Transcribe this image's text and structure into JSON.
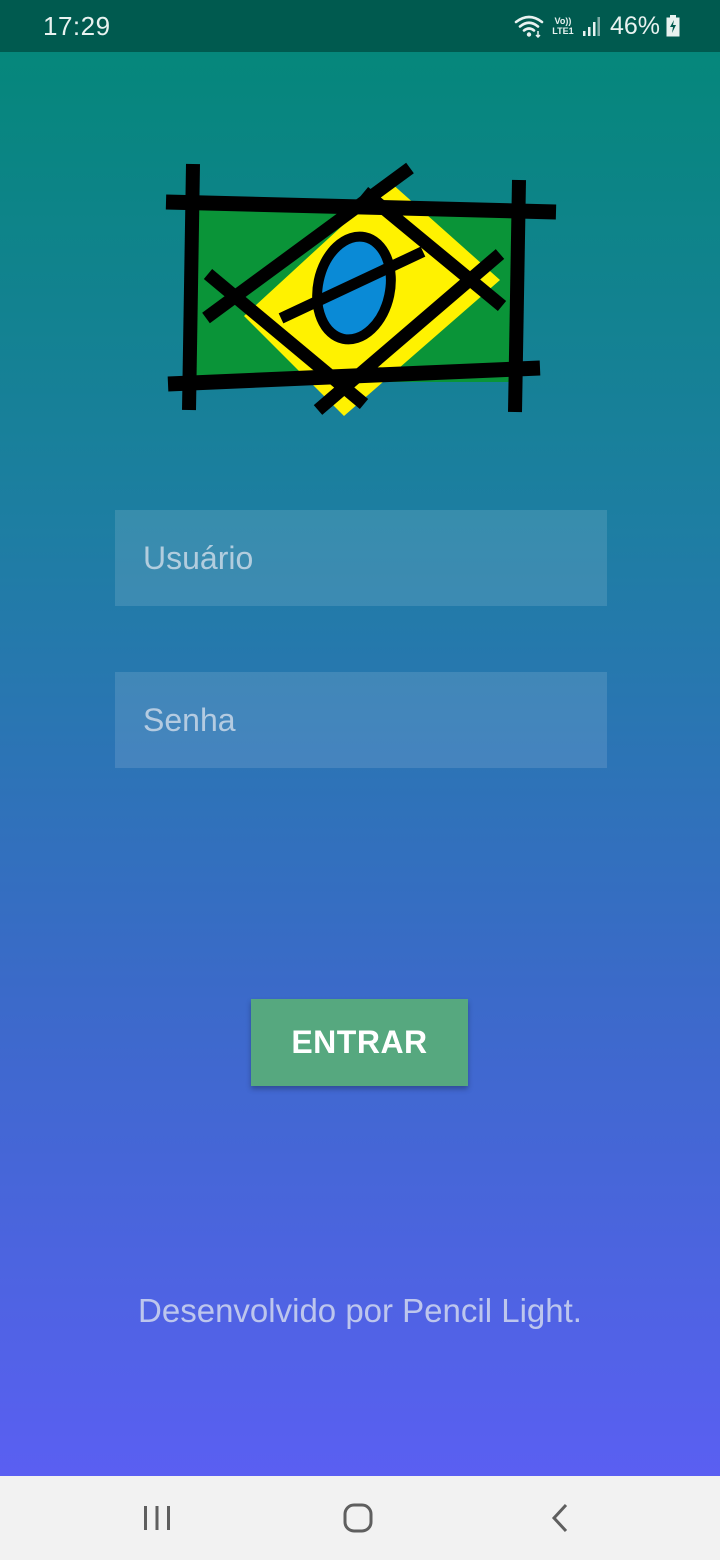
{
  "status_bar": {
    "time": "17:29",
    "volte_top": "Vo))",
    "volte_bottom": "LTE1",
    "battery": "46%",
    "icons": [
      "wifi-icon",
      "volte-icon",
      "signal-icon",
      "battery-icon"
    ]
  },
  "login": {
    "logo_icon": "brazil-flag-icon",
    "username_placeholder": "Usuário",
    "password_placeholder": "Senha",
    "enter_label": "ENTRAR",
    "credits": "Desenvolvido por Pencil Light."
  },
  "colors": {
    "status_bar": "#005a4f",
    "gradient_top": "#05877b",
    "gradient_bottom": "#5a5ff2",
    "button": "#56a87f",
    "flag_green": "#0a9438",
    "flag_yellow": "#fff200",
    "flag_blue": "#0a8ad6"
  },
  "nav_bar": {
    "icons": [
      "recents-icon",
      "home-icon",
      "back-icon"
    ]
  }
}
